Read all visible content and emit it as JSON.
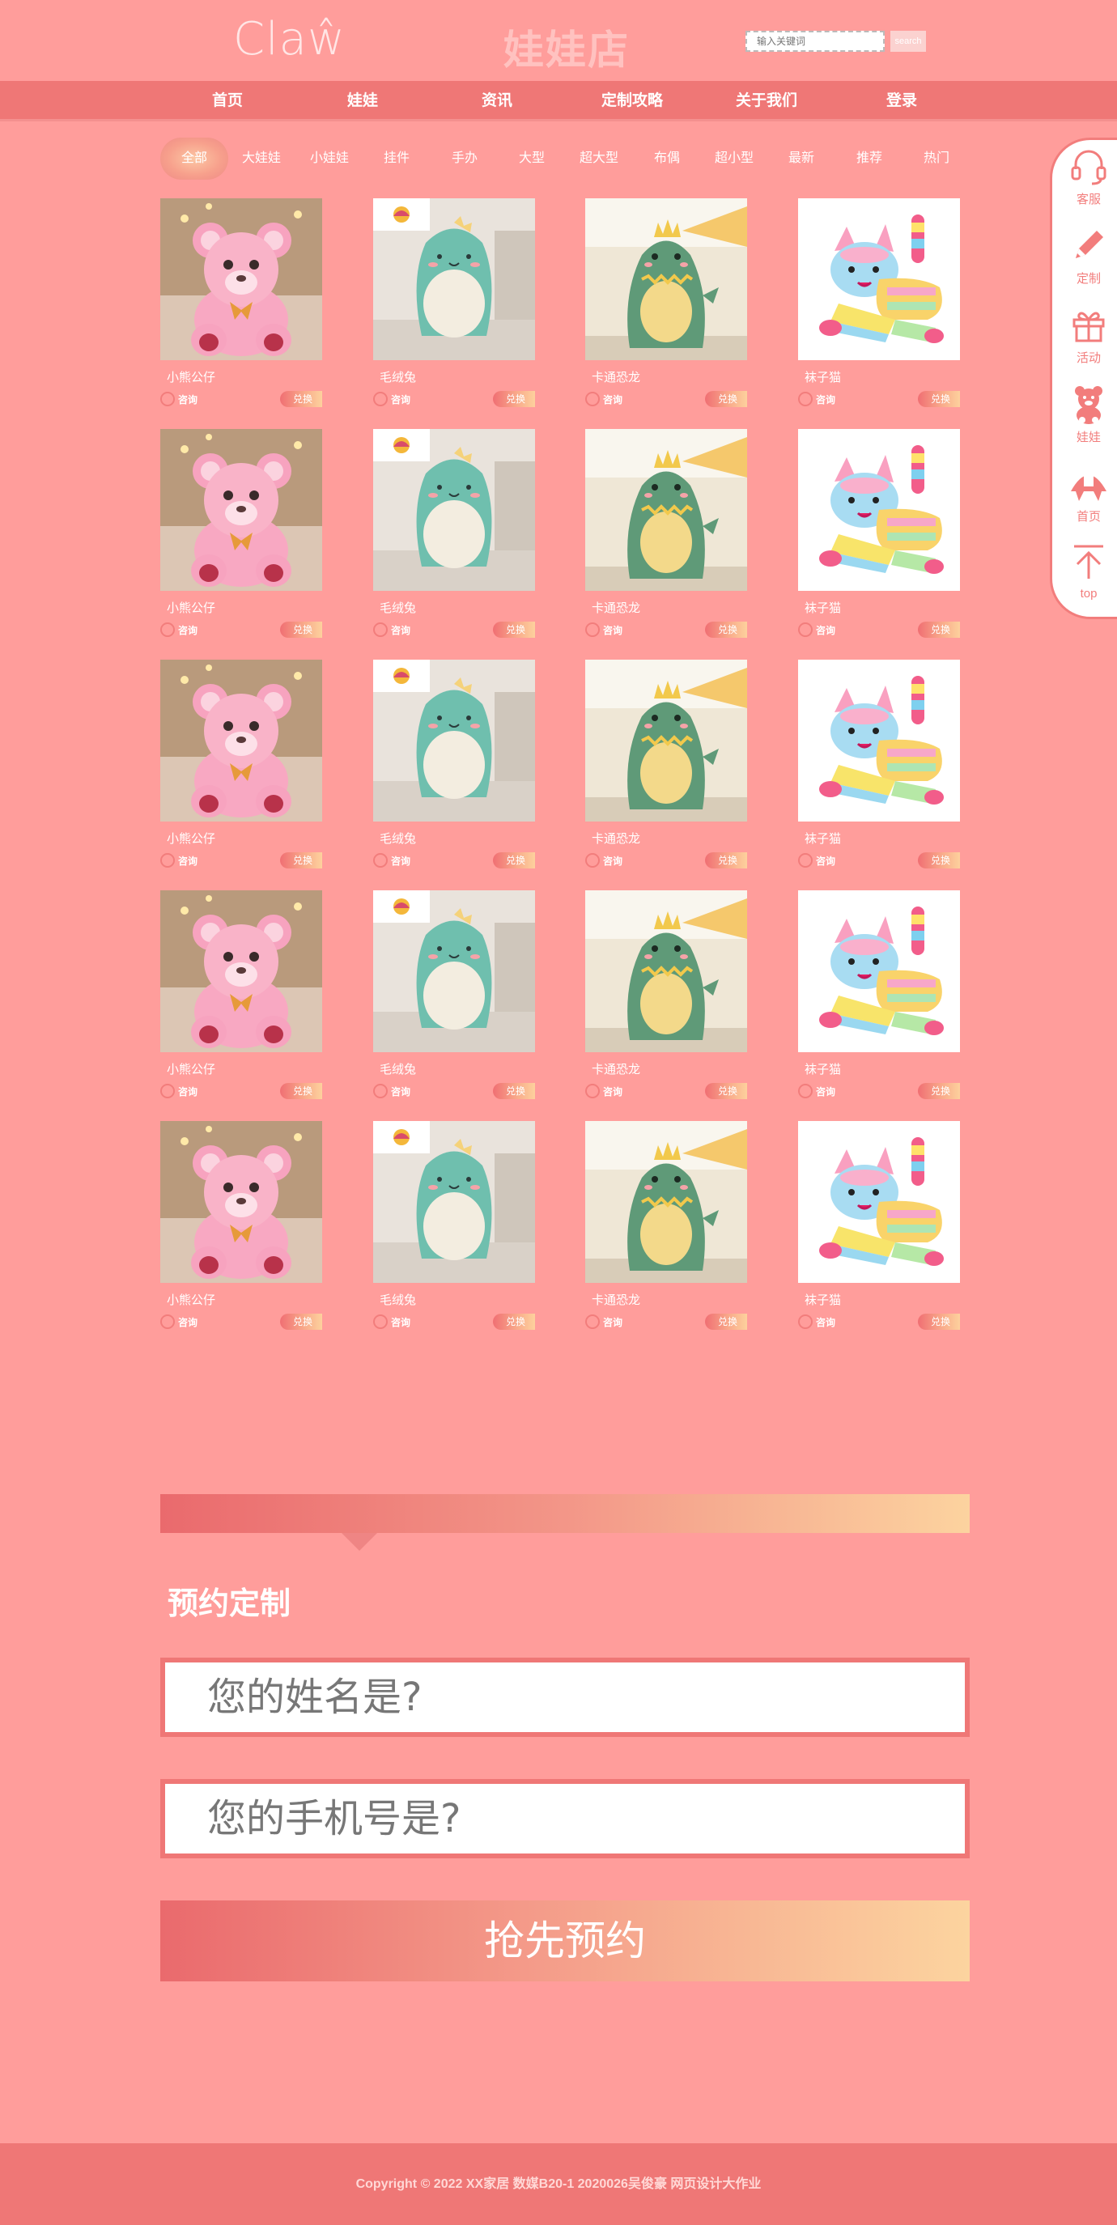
{
  "header": {
    "logo": "Claŵ",
    "title": "娃娃店",
    "search": {
      "placeholder": "输入关键词",
      "button": "search"
    }
  },
  "nav": [
    "首页",
    "娃娃",
    "资讯",
    "定制攻略",
    "关于我们",
    "登录"
  ],
  "filters": [
    "全部",
    "大娃娃",
    "小娃娃",
    "挂件",
    "手办",
    "大型",
    "超大型",
    "布偶",
    "超小型",
    "最新",
    "推荐",
    "热门"
  ],
  "active_filter": "全部",
  "products": [
    {
      "name": "小熊公仔",
      "image": "pink-teddy-bear"
    },
    {
      "name": "毛绒兔",
      "image": "green-plush-blob"
    },
    {
      "name": "卡通恐龙",
      "image": "green-dinosaur"
    },
    {
      "name": "袜子猫",
      "image": "rainbow-sock-cat"
    }
  ],
  "product_rows": 5,
  "card_labels": {
    "consult": "咨询",
    "exchange": "兑换"
  },
  "sidebar": [
    {
      "label": "客服",
      "icon": "headset-icon"
    },
    {
      "label": "定制",
      "icon": "pencil-icon"
    },
    {
      "label": "活动",
      "icon": "gift-icon"
    },
    {
      "label": "娃娃",
      "icon": "bear-icon"
    },
    {
      "label": "首页",
      "icon": "home-icon"
    },
    {
      "label": "top",
      "icon": "arrow-up-icon"
    }
  ],
  "booking": {
    "title": "预约定制",
    "name_placeholder": "您的姓名是?",
    "phone_placeholder": "您的手机号是?",
    "submit": "抢先预约"
  },
  "footer": "Copyright © 2022 XX家居 数媒B20-1 2020026吴俊豪 网页设计大作业",
  "colors": {
    "background": "#ff9d9b",
    "nav": "#ef7776",
    "accent": "#f27d7c",
    "gradient_end": "#fcd39f"
  }
}
